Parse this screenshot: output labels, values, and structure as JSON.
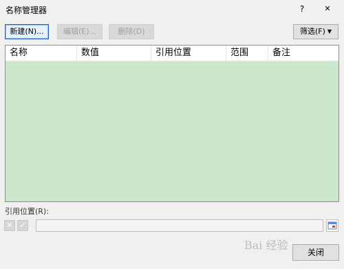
{
  "window": {
    "title": "名称管理器",
    "help_label": "?",
    "close_label": "✕"
  },
  "toolbar": {
    "new_label": "新建(N)...",
    "edit_label": "编辑(E)...",
    "delete_label": "删除(D)",
    "filter_label": "筛选(F)"
  },
  "list": {
    "columns": [
      "名称",
      "数值",
      "引用位置",
      "范围",
      "备注"
    ],
    "rows": []
  },
  "reference": {
    "label": "引用位置(R):",
    "value": ""
  },
  "footer": {
    "close_label": "关闭"
  },
  "watermark": {
    "text": "Bai 经验"
  },
  "colors": {
    "list_bg": "#cce8cc",
    "focus_border": "#1e5ec8"
  }
}
